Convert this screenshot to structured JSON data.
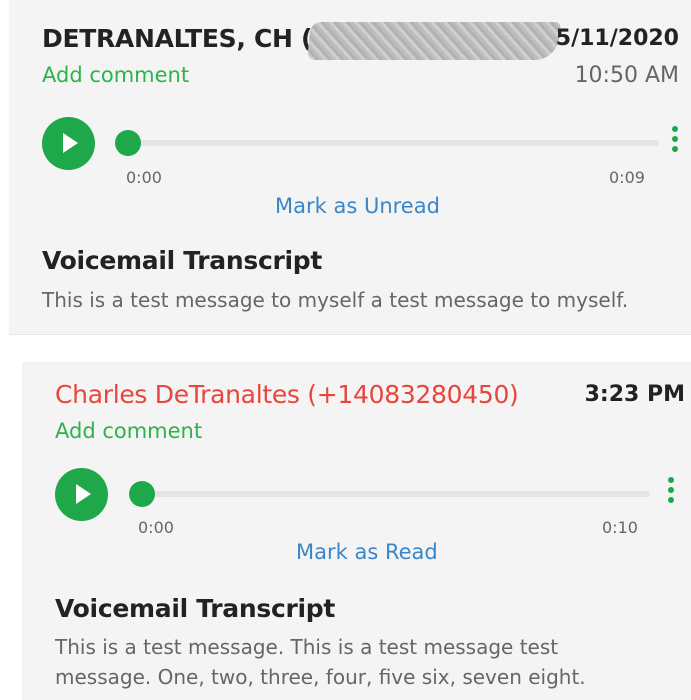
{
  "voicemails": [
    {
      "caller": "DETRANALTES, CH (",
      "date": "5/11/2020",
      "time": "10:50 AM",
      "add_comment": "Add comment",
      "start_time": "0:00",
      "duration": "0:09",
      "progress": 0,
      "mark_action": "Mark as Unread",
      "transcript_title": "Voicemail Transcript",
      "transcript": "This is a test message to myself a test message to myself."
    },
    {
      "caller": "Charles DeTranaltes (+14083280450)",
      "time": "3:23 PM",
      "add_comment": "Add comment",
      "start_time": "0:00",
      "duration": "0:10",
      "progress": 0,
      "mark_action": "Mark as Read",
      "transcript_title": "Voicemail Transcript",
      "transcript": "This is a test message. This is a test message test message. One, two, three, four, five six, seven eight."
    }
  ],
  "icons": {
    "play": "play-icon",
    "more": "more-vertical-icon"
  },
  "colors": {
    "accent_green": "#1fa84a",
    "unread_caller": "#e8453c",
    "link_blue": "#3a86c8"
  }
}
